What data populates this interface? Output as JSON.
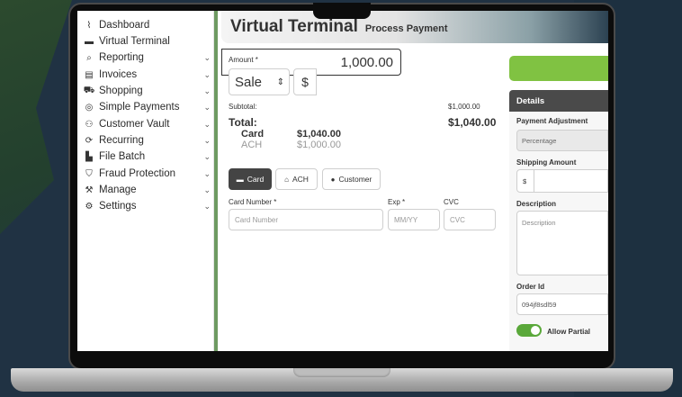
{
  "sidebar": {
    "items": [
      {
        "label": "Dashboard",
        "icon": "chart-line-icon",
        "glyph": "⌇",
        "has_chevron": false
      },
      {
        "label": "Virtual Terminal",
        "icon": "card-icon",
        "glyph": "▬",
        "has_chevron": false
      },
      {
        "label": "Reporting",
        "icon": "search-icon",
        "glyph": "⌕",
        "has_chevron": true
      },
      {
        "label": "Invoices",
        "icon": "invoice-icon",
        "glyph": "▤",
        "has_chevron": true
      },
      {
        "label": "Shopping",
        "icon": "cart-icon",
        "glyph": "⛟",
        "has_chevron": true
      },
      {
        "label": "Simple Payments",
        "icon": "coin-icon",
        "glyph": "◎",
        "has_chevron": true
      },
      {
        "label": "Customer Vault",
        "icon": "users-icon",
        "glyph": "⚇",
        "has_chevron": true
      },
      {
        "label": "Recurring",
        "icon": "sync-icon",
        "glyph": "⟳",
        "has_chevron": true
      },
      {
        "label": "File Batch",
        "icon": "file-icon",
        "glyph": "▙",
        "has_chevron": true
      },
      {
        "label": "Fraud Protection",
        "icon": "shield-icon",
        "glyph": "⛉",
        "has_chevron": true
      },
      {
        "label": "Manage",
        "icon": "wrench-icon",
        "glyph": "⚒",
        "has_chevron": true
      },
      {
        "label": "Settings",
        "icon": "gear-icon",
        "glyph": "⚙",
        "has_chevron": true
      }
    ],
    "chevron": "⌄"
  },
  "header": {
    "title": "Virtual Terminal",
    "subtitle": "Process Payment"
  },
  "form": {
    "amount_label": "Amount *",
    "transaction_type": "Sale",
    "currency_symbol": "$",
    "amount_value": "1,000.00",
    "subtotal_label": "Subtotal:",
    "subtotal_value": "$1,000.00",
    "total_label": "Total:",
    "total_value": "$1,040.00",
    "card_label": "Card",
    "card_value": "$1,040.00",
    "ach_label": "ACH",
    "ach_value": "$1,000.00",
    "tabs": {
      "card": "Card",
      "ach": "ACH",
      "customer": "Customer"
    },
    "card_number_label": "Card Number *",
    "card_number_placeholder": "Card Number",
    "exp_label": "Exp *",
    "exp_placeholder": "MM/YY",
    "cvc_label": "CVC",
    "cvc_placeholder": "CVC"
  },
  "details": {
    "header": "Details",
    "payment_adjustment_label": "Payment Adjustment",
    "payment_adjustment_value": "Percentage",
    "shipping_amount_label": "Shipping Amount",
    "shipping_currency": "$",
    "description_label": "Description",
    "description_placeholder": "Description",
    "order_id_label": "Order Id",
    "order_id_value": "094jf8sdl59",
    "allow_partial_label": "Allow Partial",
    "allow_partial_on": true
  },
  "colors": {
    "accent_green": "#80c242",
    "rail_green": "#6e9a62",
    "toggle_green": "#5aa83a",
    "active_tab": "#444444"
  }
}
